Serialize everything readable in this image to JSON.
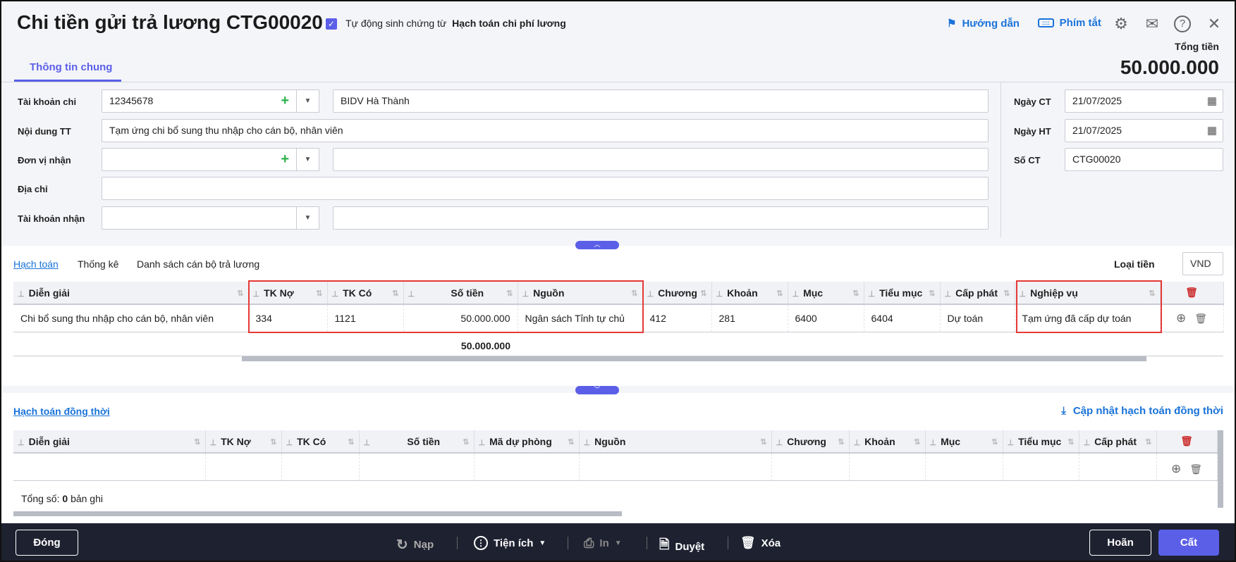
{
  "header": {
    "title": "Chi tiền gửi trả lương CTG00020",
    "auto_label": "Tự động sinh chứng từ",
    "auto_value": "Hạch toán chi phí lương",
    "guide": "Hướng dẫn",
    "shortcuts": "Phím tắt",
    "total_label": "Tổng tiền",
    "total_value": "50.000.000",
    "tab": "Thông tin chung"
  },
  "form": {
    "tk_chi_label": "Tài khoản chi",
    "tk_chi": "12345678",
    "bank": "BIDV Hà Thành",
    "noi_dung_label": "Nội dung TT",
    "noi_dung": "Tạm ứng chi bổ sung thu nhập cho cán bộ, nhân viên",
    "don_vi_label": "Đơn vị nhận",
    "dia_chi_label": "Địa chỉ",
    "tk_nhan_label": "Tài khoản nhận",
    "ngay_ct_label": "Ngày CT",
    "ngay_ct": "21/07/2025",
    "ngay_ht_label": "Ngày HT",
    "ngay_ht": "21/07/2025",
    "so_ct_label": "Số CT",
    "so_ct": "CTG00020"
  },
  "detail": {
    "tabs": [
      "Hạch toán",
      "Thống kê",
      "Danh sách cán bộ trả lương"
    ],
    "currency_label": "Loại tiền",
    "currency": "VND",
    "columns": [
      "Diễn giải",
      "TK Nợ",
      "TK Có",
      "Số tiền",
      "Nguồn",
      "Chương",
      "Khoản",
      "Mục",
      "Tiểu mục",
      "Cấp phát",
      "Nghiệp vụ"
    ],
    "rows": [
      [
        "Chi bổ sung thu nhập cho cán bộ, nhân viên",
        "334",
        "1121",
        "50.000.000",
        "Ngân sách Tỉnh tự chủ",
        "412",
        "281",
        "6400",
        "6404",
        "Dự toán",
        "Tạm ứng đã cấp dự toán"
      ]
    ],
    "total": "50.000.000"
  },
  "concurrent": {
    "title": "Hạch toán đồng thời",
    "update": "Cập nhật hạch toán đồng thời",
    "columns": [
      "Diễn giải",
      "TK Nợ",
      "TK Có",
      "Số tiền",
      "Mã dự phòng",
      "Nguồn",
      "Chương",
      "Khoản",
      "Mục",
      "Tiểu mục",
      "Cấp phát"
    ],
    "count_prefix": "Tổng số:",
    "count": "0",
    "count_suffix": "bản ghi"
  },
  "footer": {
    "close": "Đóng",
    "reload": "Nạp",
    "utilities": "Tiện ích",
    "print": "In",
    "approve": "Duyệt",
    "delete": "Xóa",
    "undo": "Hoãn",
    "save": "Cất"
  }
}
